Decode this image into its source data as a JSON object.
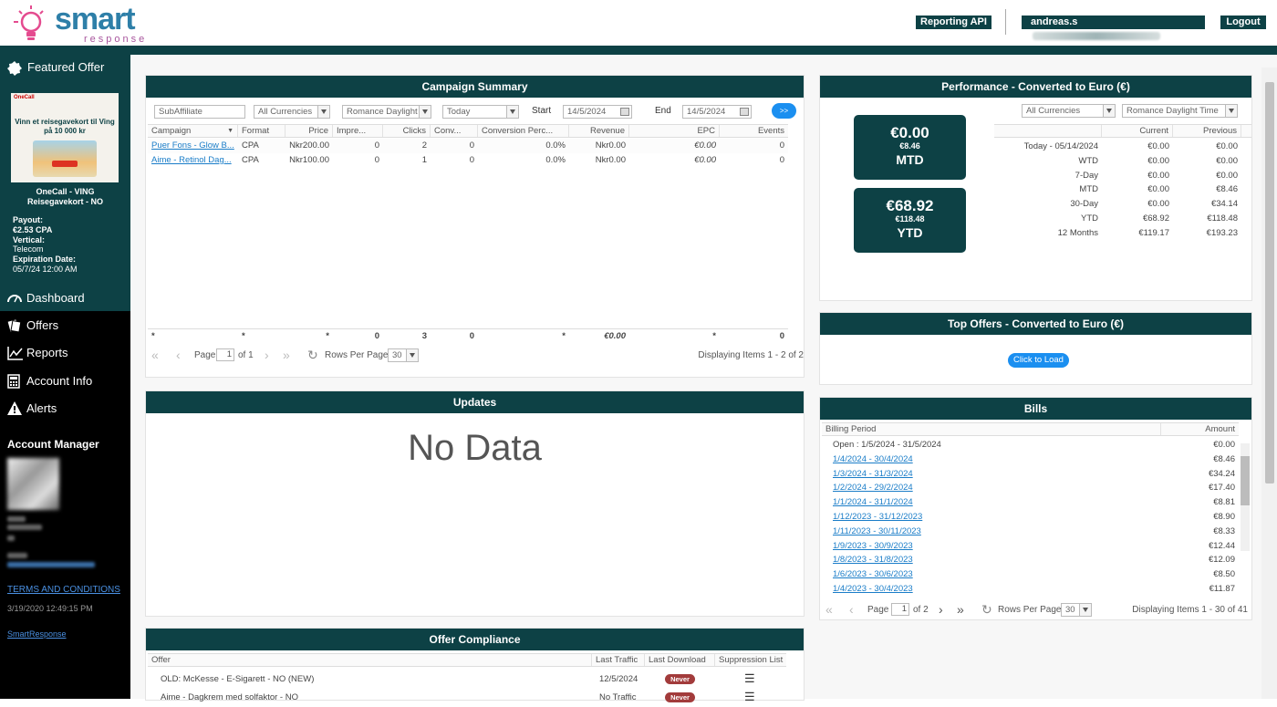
{
  "header": {
    "brand": "smart",
    "tagline": "response",
    "reporting_api": "Reporting API",
    "user": "andreas.s",
    "logout": "Logout",
    "accent": "#0d4145"
  },
  "sidebar": {
    "featured_title": "Featured Offer",
    "ad_brand": "OneCall",
    "ad_text": "Vinn et reisegavekort til Ving på 10 000 kr",
    "offer_name_line1": "OneCall - VING",
    "offer_name_line2": "Reisegavekort - NO",
    "payout_label": "Payout:",
    "payout_value": "€2.53 CPA",
    "vertical_label": "Vertical:",
    "vertical_value": "Telecom",
    "expiration_label": "Expiration Date:",
    "expiration_value": "05/7/24 12:00 AM",
    "nav": [
      {
        "label": "Dashboard",
        "icon": "dashboard-icon",
        "active": true
      },
      {
        "label": "Offers",
        "icon": "offers-icon"
      },
      {
        "label": "Reports",
        "icon": "reports-icon"
      },
      {
        "label": "Account Info",
        "icon": "calculator-icon"
      },
      {
        "label": "Alerts",
        "icon": "alert-icon"
      }
    ],
    "account_manager": "Account Manager",
    "terms": "TERMS AND CONDITIONS",
    "timestamp": "3/19/2020 12:49:15 PM",
    "footer_link": "SmartResponse"
  },
  "campaign": {
    "title": "Campaign Summary",
    "subaffiliate_placeholder": "SubAffiliate",
    "currency": "All Currencies",
    "timezone": "Romance Daylight",
    "range": "Today",
    "start_label": "Start",
    "start": "14/5/2024",
    "end_label": "End",
    "end": "14/5/2024",
    "go": ">>",
    "columns": [
      "Campaign",
      "Format",
      "Price",
      "Impre...",
      "Clicks",
      "Conv...",
      "Conversion Perc...",
      "Revenue",
      "EPC",
      "Events"
    ],
    "rows": [
      [
        "Puer Fons - Glow B...",
        "CPA",
        "Nkr200.00",
        "0",
        "2",
        "0",
        "0.0%",
        "Nkr0.00",
        "€0.00",
        "0"
      ],
      [
        "Aime - Retinol Dag...",
        "CPA",
        "Nkr100.00",
        "0",
        "1",
        "0",
        "0.0%",
        "Nkr0.00",
        "€0.00",
        "0"
      ]
    ],
    "totals": [
      "*",
      "*",
      "*",
      "0",
      "3",
      "0",
      "*",
      "€0.00",
      "*",
      "0"
    ],
    "page_label": "Page",
    "page": "1",
    "of": "of 1",
    "rows_per_page_label": "Rows Per Page:",
    "rows_per_page": "30",
    "displaying": "Displaying Items 1 - 2 of 2"
  },
  "performance": {
    "title": "Performance - Converted to Euro (€)",
    "mtd_value": "€0.00",
    "mtd_prev": "€8.46",
    "mtd_label": "MTD",
    "ytd_value": "€68.92",
    "ytd_prev": "€118.48",
    "ytd_label": "YTD",
    "currency": "All Currencies",
    "timezone": "Romance Daylight Time",
    "col_current": "Current",
    "col_previous": "Previous",
    "rows": [
      [
        "Today - 05/14/2024",
        "€0.00",
        "€0.00"
      ],
      [
        "WTD",
        "€0.00",
        "€0.00"
      ],
      [
        "7-Day",
        "€0.00",
        "€0.00"
      ],
      [
        "MTD",
        "€0.00",
        "€8.46"
      ],
      [
        "30-Day",
        "€0.00",
        "€34.14"
      ],
      [
        "YTD",
        "€68.92",
        "€118.48"
      ],
      [
        "12 Months",
        "€119.17",
        "€193.23"
      ]
    ]
  },
  "top_offers": {
    "title": "Top Offers - Converted to Euro (€)",
    "load": "Click to Load"
  },
  "updates": {
    "title": "Updates",
    "empty": "No Data"
  },
  "bills": {
    "title": "Bills",
    "col_period": "Billing Period",
    "col_amount": "Amount",
    "rows": [
      [
        "Open : 1/5/2024 - 31/5/2024",
        "€0.00"
      ],
      [
        "1/4/2024 - 30/4/2024",
        "€8.46"
      ],
      [
        "1/3/2024 - 31/3/2024",
        "€34.24"
      ],
      [
        "1/2/2024 - 29/2/2024",
        "€17.40"
      ],
      [
        "1/1/2024 - 31/1/2024",
        "€8.81"
      ],
      [
        "1/12/2023 - 31/12/2023",
        "€8.90"
      ],
      [
        "1/11/2023 - 30/11/2023",
        "€8.33"
      ],
      [
        "1/9/2023 - 30/9/2023",
        "€12.44"
      ],
      [
        "1/8/2023 - 31/8/2023",
        "€12.09"
      ],
      [
        "1/6/2023 - 30/6/2023",
        "€8.50"
      ],
      [
        "1/4/2023 - 30/4/2023",
        "€11.87"
      ]
    ],
    "page_label": "Page",
    "page": "1",
    "of": "of 2",
    "rows_per_page_label": "Rows Per Page:",
    "rows_per_page": "30",
    "displaying": "Displaying Items 1 - 30 of 41"
  },
  "compliance": {
    "title": "Offer Compliance",
    "columns": [
      "Offer",
      "Last Traffic",
      "Last Download",
      "Suppression List"
    ],
    "rows": [
      [
        "OLD: McKesse - E-Sigarett - NO (NEW)",
        "12/5/2024",
        "Never"
      ],
      [
        "Aime - Dagkrem med solfaktor - NO",
        "No Traffic",
        "Never"
      ]
    ]
  }
}
